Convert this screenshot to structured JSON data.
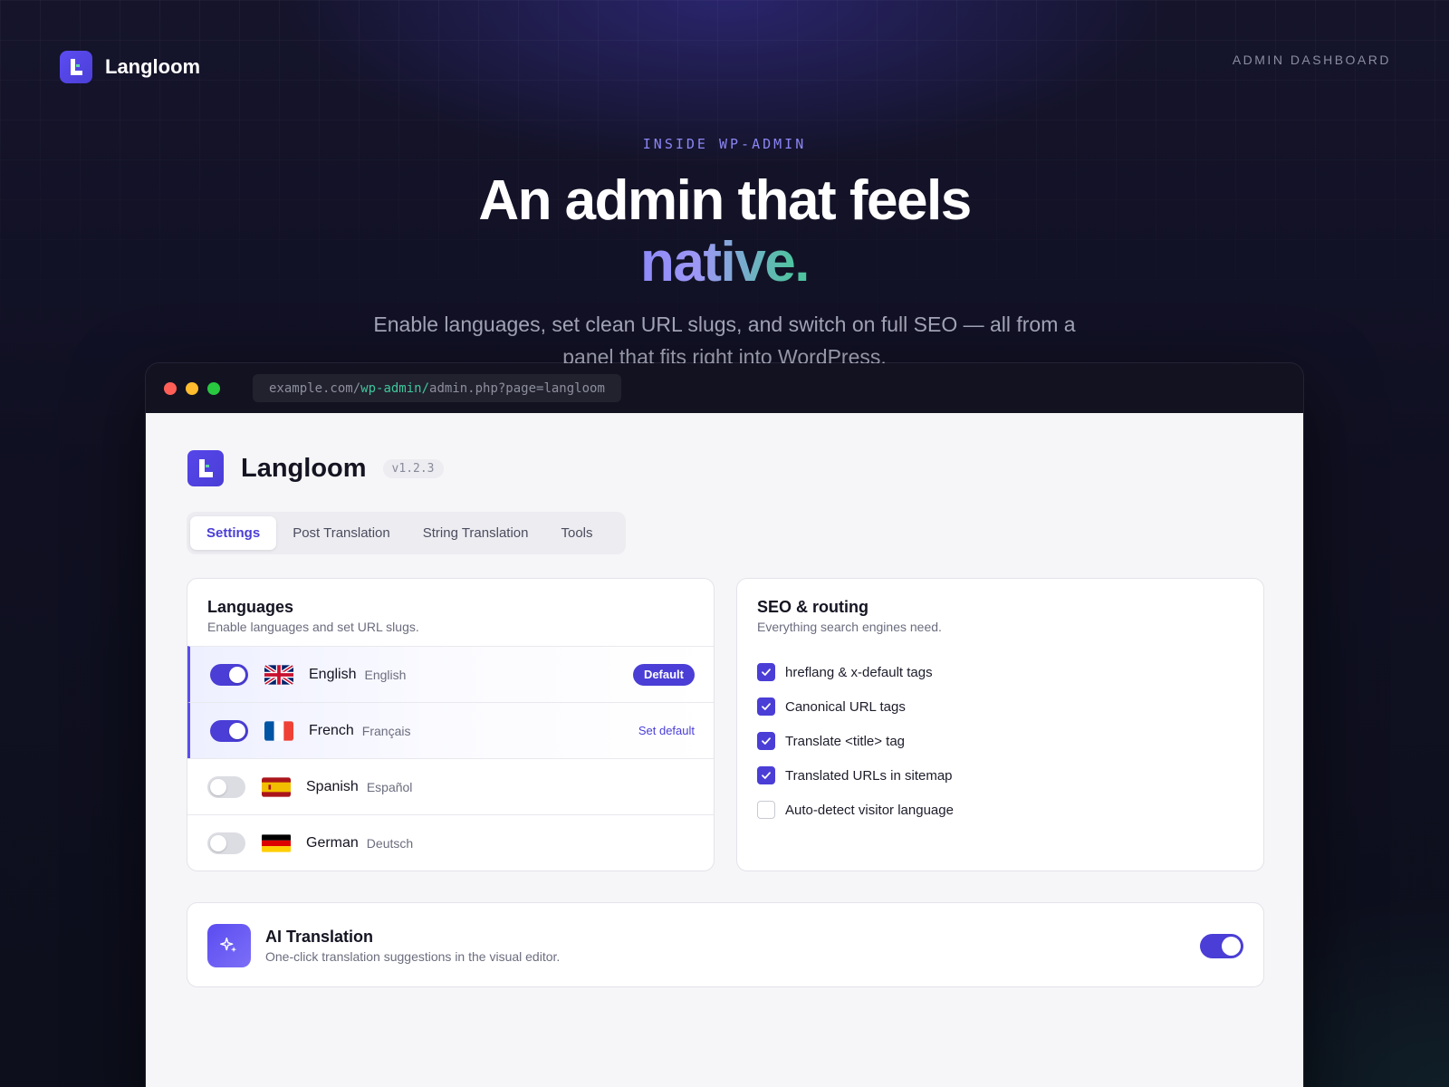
{
  "site": {
    "brand": "Langloom",
    "nav_link": "ADMIN DASHBOARD"
  },
  "hero": {
    "eyebrow": "INSIDE WP-ADMIN",
    "title_line1": "An admin that feels",
    "title_accent": "native.",
    "subtitle": "Enable languages, set clean URL slugs, and switch on full SEO — all from a panel that fits right into WordPress."
  },
  "browser": {
    "url_domain": "example.com/",
    "url_path_highlight": "wp-admin/",
    "url_rest": "admin.php?page=langloom"
  },
  "app": {
    "name": "Langloom",
    "version": "v1.2.3",
    "tabs": [
      {
        "label": "Settings",
        "active": true
      },
      {
        "label": "Post Translation",
        "active": false
      },
      {
        "label": "String Translation",
        "active": false
      },
      {
        "label": "Tools",
        "active": false
      }
    ]
  },
  "languages": {
    "title": "Languages",
    "subtitle": "Enable languages and set URL slugs.",
    "items": [
      {
        "name": "English",
        "native": "English",
        "enabled": true,
        "flag": "uk-flag",
        "action": "Default"
      },
      {
        "name": "French",
        "native": "Français",
        "enabled": true,
        "flag": "france-flag",
        "action": "Set default"
      },
      {
        "name": "Spanish",
        "native": "Español",
        "enabled": false,
        "flag": "spain-flag",
        "action": ""
      },
      {
        "name": "German",
        "native": "Deutsch",
        "enabled": false,
        "flag": "germany-flag",
        "action": ""
      }
    ]
  },
  "seo": {
    "title": "SEO & routing",
    "subtitle": "Everything search engines need.",
    "options": [
      {
        "label": "hreflang & x-default tags",
        "checked": true
      },
      {
        "label": "Canonical URL tags",
        "checked": true
      },
      {
        "label": "Translate <title> tag",
        "checked": true
      },
      {
        "label": "Translated URLs in sitemap",
        "checked": true
      },
      {
        "label": "Auto-detect visitor language",
        "checked": false
      }
    ]
  },
  "ai": {
    "title": "AI Translation",
    "subtitle": "One-click translation suggestions in the visual editor.",
    "enabled": true,
    "icon": "sparkle-icon"
  },
  "colors": {
    "accent": "#4a3ed6",
    "green": "#3fc69a",
    "bg": "#0f0f1e"
  }
}
